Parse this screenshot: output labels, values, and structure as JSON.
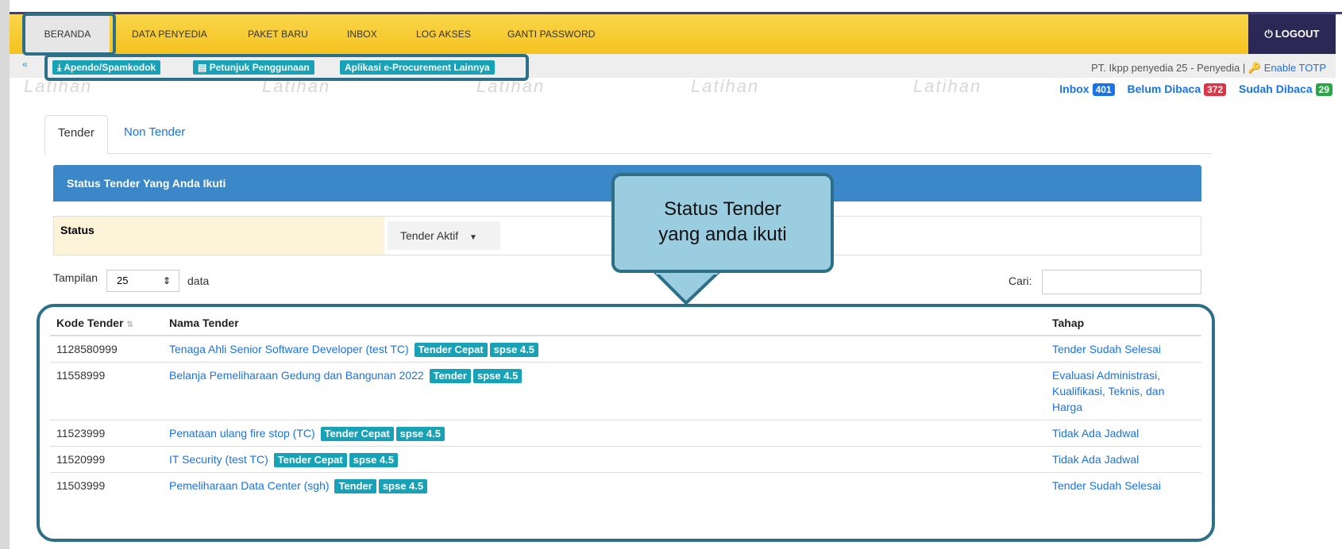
{
  "nav": {
    "items": [
      "BERANDA",
      "DATA PENYEDIA",
      "PAKET BARU",
      "INBOX",
      "LOG AKSES",
      "GANTI PASSWORD"
    ],
    "logout": "LOGOUT",
    "bg_color": "#f5c21f",
    "logout_bg": "#2b2856"
  },
  "subbar": {
    "buttons": [
      "Apendo/Spamkodok",
      "Petunjuk Penggunaan",
      "Aplikasi e-Procurement Lainnya"
    ],
    "account": "PT. Ikpp penyedia 25 - Penyedia |",
    "enable_totp": "Enable TOTP",
    "accent": "#17a2b8"
  },
  "watermark": "Latihan",
  "counters": {
    "inbox_label": "Inbox",
    "inbox_count": "401",
    "unread_label": "Belum Dibaca",
    "unread_count": "372",
    "read_label": "Sudah Dibaca",
    "read_count": "29"
  },
  "tabs": [
    "Tender",
    "Non Tender"
  ],
  "panel": {
    "title": "Status Tender Yang Anda Ikuti",
    "status_label": "Status",
    "status_value": "Tender Aktif",
    "header_color": "#3c87c8"
  },
  "list_controls": {
    "show_label": "Tampilan",
    "show_value": "25",
    "data_label": "data",
    "search_label": "Cari:"
  },
  "table": {
    "columns": [
      "Kode Tender",
      "Nama Tender",
      "Tahap"
    ],
    "rows": [
      {
        "kode": "1128580999",
        "nama": "Tenaga Ahli Senior Software Developer (test TC)",
        "tags": [
          "Tender Cepat",
          "spse 4.5"
        ],
        "tahap": "Tender Sudah Selesai"
      },
      {
        "kode": "11558999",
        "nama": "Belanja Pemeliharaan Gedung dan Bangunan 2022",
        "tags": [
          "Tender",
          "spse 4.5"
        ],
        "tahap": "Evaluasi Administrasi, Kualifikasi, Teknis, dan Harga"
      },
      {
        "kode": "11523999",
        "nama": "Penataan ulang fire stop (TC)",
        "tags": [
          "Tender Cepat",
          "spse 4.5"
        ],
        "tahap": "Tidak Ada Jadwal"
      },
      {
        "kode": "11520999",
        "nama": "IT Security (test TC)",
        "tags": [
          "Tender Cepat",
          "spse 4.5"
        ],
        "tahap": "Tidak Ada Jadwal"
      },
      {
        "kode": "11503999",
        "nama": "Pemeliharaan Data Center (sgh)",
        "tags": [
          "Tender",
          "spse 4.5"
        ],
        "tahap": "Tender Sudah Selesai"
      }
    ]
  },
  "callout": {
    "line1": "Status Tender",
    "line2": "yang anda ikuti",
    "fill": "#9bcde0",
    "stroke": "#2d6f86"
  }
}
